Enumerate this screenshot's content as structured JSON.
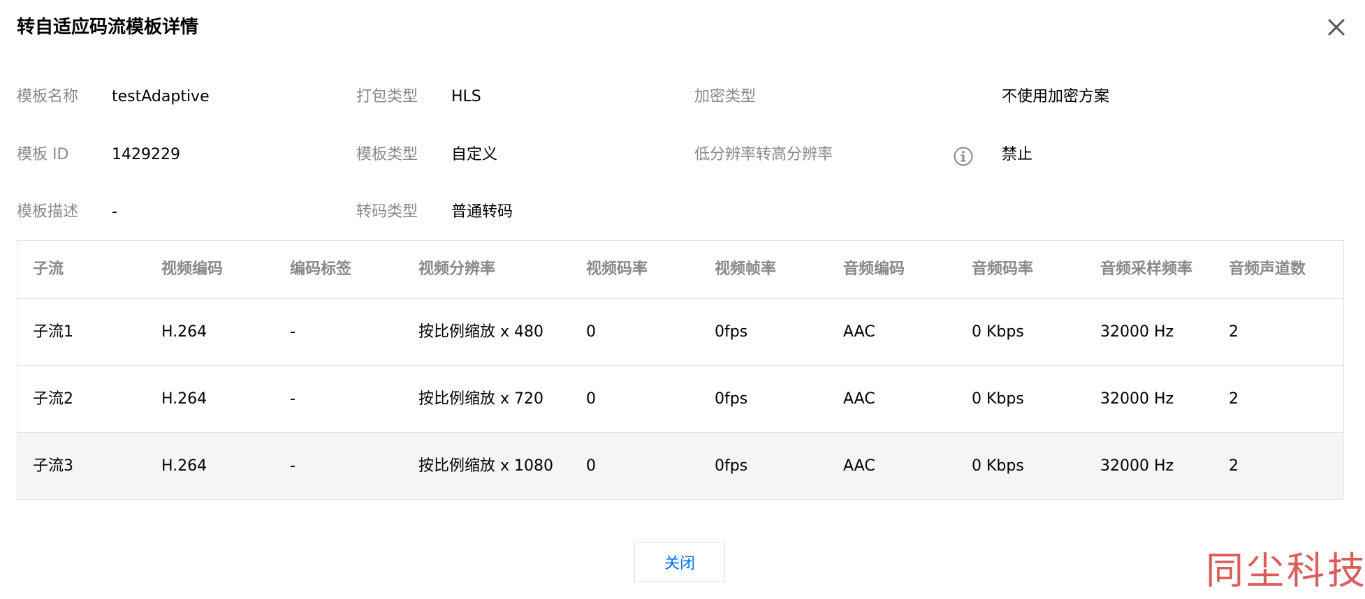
{
  "dialog": {
    "title": "转自适应码流模板详情",
    "close_button_label": "关闭",
    "watermark_text": "同尘科技"
  },
  "info": {
    "template_name_label": "模板名称",
    "template_name_value": "testAdaptive",
    "package_type_label": "打包类型",
    "package_type_value": "HLS",
    "encryption_type_label": "加密类型",
    "encryption_type_value": "不使用加密方案",
    "template_id_label": "模板 ID",
    "template_id_value": "1429229",
    "template_type_label": "模板类型",
    "template_type_value": "自定义",
    "upscale_label": "低分辨率转高分辨率",
    "upscale_value": "禁止",
    "template_desc_label": "模板描述",
    "template_desc_value": "-",
    "transcode_type_label": "转码类型",
    "transcode_type_value": "普通转码"
  },
  "table": {
    "headers": [
      "子流",
      "视频编码",
      "编码标签",
      "视频分辨率",
      "视频码率",
      "视频帧率",
      "音频编码",
      "音频码率",
      "音频采样频率",
      "音频声道数"
    ],
    "rows": [
      [
        "子流1",
        "H.264",
        "-",
        "按比例缩放 x 480",
        "0",
        "0fps",
        "AAC",
        "0 Kbps",
        "32000 Hz",
        "2"
      ],
      [
        "子流2",
        "H.264",
        "-",
        "按比例缩放 x 720",
        "0",
        "0fps",
        "AAC",
        "0 Kbps",
        "32000 Hz",
        "2"
      ],
      [
        "子流3",
        "H.264",
        "-",
        "按比例缩放 x 1080",
        "0",
        "0fps",
        "AAC",
        "0 Kbps",
        "32000 Hz",
        "2"
      ]
    ]
  },
  "icons": {
    "close": "close-icon",
    "help": "info-circle-icon"
  },
  "colors": {
    "accent": "#006eff",
    "label": "#888888",
    "watermark": "#d44040"
  }
}
